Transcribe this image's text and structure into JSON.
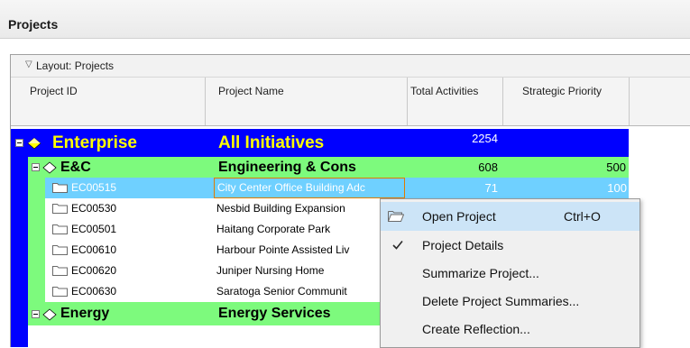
{
  "panel": {
    "title": "Projects"
  },
  "layout_bar": {
    "label": "Layout: Projects"
  },
  "columns": [
    "Project ID",
    "Project Name",
    "Total Activities",
    "Strategic Priority"
  ],
  "enterprise": {
    "id": "Enterprise",
    "name": "All Initiatives",
    "total": "2254"
  },
  "group_ec": {
    "id": "E&C",
    "name": "Engineering & Cons",
    "total": "608",
    "priority": "500"
  },
  "projects": [
    {
      "id": "EC00515",
      "name": "City Center Office Building Adc",
      "total": "71",
      "priority": "100"
    },
    {
      "id": "EC00530",
      "name": "Nesbid Building Expansion",
      "total": "",
      "priority": ""
    },
    {
      "id": "EC00501",
      "name": "Haitang Corporate Park",
      "total": "",
      "priority": ""
    },
    {
      "id": "EC00610",
      "name": "Harbour Pointe Assisted Liv",
      "total": "",
      "priority": ""
    },
    {
      "id": "EC00620",
      "name": "Juniper Nursing Home",
      "total": "",
      "priority": ""
    },
    {
      "id": "EC00630",
      "name": "Saratoga Senior Communit",
      "total": "",
      "priority": ""
    }
  ],
  "group_energy": {
    "id": "Energy",
    "name": "Energy Services"
  },
  "context_menu": {
    "items": [
      {
        "label": "Open Project",
        "shortcut": "Ctrl+O"
      },
      {
        "label": "Project Details"
      },
      {
        "label": "Summarize Project..."
      },
      {
        "label": "Delete Project Summaries..."
      },
      {
        "label": "Create Reflection..."
      }
    ]
  },
  "colors": {
    "enterprise_bg": "#0000ff",
    "enterprise_text": "#ffff00",
    "group_bg": "#7dfa7d",
    "selection_bg": "#6fd0ff",
    "menu_highlight": "#cce4f7"
  }
}
